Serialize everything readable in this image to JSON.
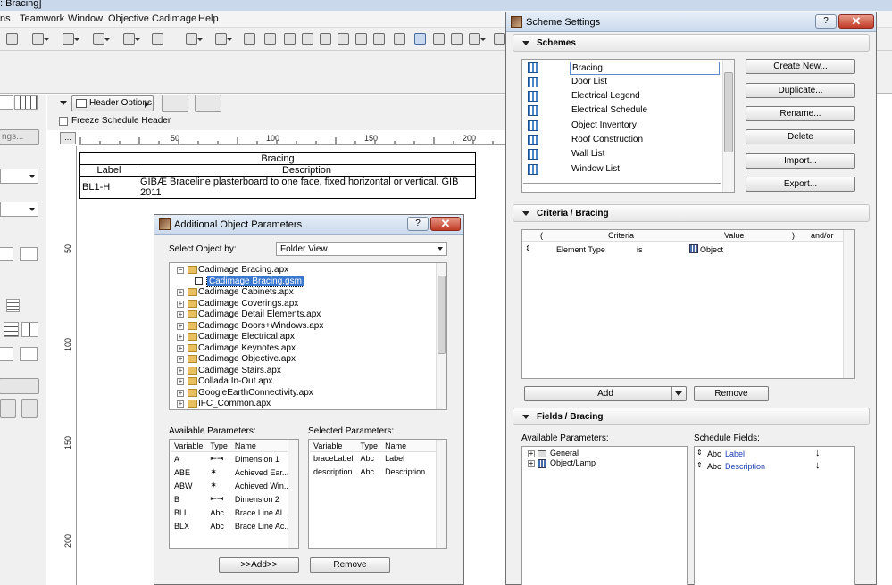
{
  "app": {
    "title_fragment": ": Bracing]",
    "menu": [
      "ns",
      "Teamwork",
      "Window",
      "Objective",
      "Cadimage",
      "Help"
    ]
  },
  "schedule": {
    "header_options_label": "Header Options",
    "freeze_label": "Freeze Schedule Header",
    "ruler_button": "...",
    "ruler_marks": [
      "50",
      "100",
      "150",
      "200"
    ],
    "vruler_marks": [
      "50",
      "100",
      "150",
      "200"
    ],
    "left_labels": {
      "ngs": "ngs..."
    },
    "table": {
      "title": "Bracing",
      "col_label": "Label",
      "col_description": "Description",
      "row": {
        "label": "BL1-H",
        "description": "GIBÆ Braceline plasterboard to one face, fixed horizontal  or vertical. GIB 2011"
      }
    }
  },
  "additional_object_parameters": {
    "title": "Additional Object Parameters",
    "help": "?",
    "select_label": "Select Object by:",
    "select_value": "Folder View",
    "tree": [
      {
        "label": "Cadimage Bracing.apx",
        "expanded": true
      },
      {
        "label": "Cadimage Bracing.gsm",
        "child": true,
        "selected": true
      },
      {
        "label": "Cadimage Cabinets.apx"
      },
      {
        "label": "Cadimage Coverings.apx"
      },
      {
        "label": "Cadimage Detail Elements.apx"
      },
      {
        "label": "Cadimage Doors+Windows.apx"
      },
      {
        "label": "Cadimage Electrical.apx"
      },
      {
        "label": "Cadimage Keynotes.apx"
      },
      {
        "label": "Cadimage Objective.apx"
      },
      {
        "label": "Cadimage Stairs.apx"
      },
      {
        "label": "Collada In-Out.apx"
      },
      {
        "label": "GoogleEarthConnectivity.apx"
      },
      {
        "label": "IFC_Common.apx"
      }
    ],
    "available_label": "Available Parameters:",
    "selected_label": "Selected Parameters:",
    "columns": {
      "variable": "Variable",
      "type": "Type",
      "name": "Name"
    },
    "available": [
      {
        "variable": "A",
        "type_icon": "dimension-icon",
        "name": "Dimension 1"
      },
      {
        "variable": "ABE",
        "type_icon": "angle-icon",
        "name": "Achieved Ear..."
      },
      {
        "variable": "ABW",
        "type_icon": "angle-icon",
        "name": "Achieved Win..."
      },
      {
        "variable": "B",
        "type_icon": "dimension-icon",
        "name": "Dimension 2"
      },
      {
        "variable": "BLL",
        "type": "Abc",
        "name": "Brace Line Al..."
      },
      {
        "variable": "BLX",
        "type": "Abc",
        "name": "Brace Line Ac..."
      }
    ],
    "selected": [
      {
        "variable": "braceLabel",
        "type": "Abc",
        "name": "Label"
      },
      {
        "variable": "description",
        "type": "Abc",
        "name": "Description"
      }
    ],
    "add_button": ">>Add>>",
    "remove_button": "Remove"
  },
  "scheme_settings": {
    "title": "Scheme Settings",
    "help": "?",
    "close": "✕",
    "schemes_header": "Schemes",
    "schemes": [
      "Bracing",
      "Door List",
      "Electrical Legend",
      "Electrical Schedule",
      "Object Inventory",
      "Roof Construction",
      "Wall List",
      "Window List"
    ],
    "buttons": [
      "Create New...",
      "Duplicate...",
      "Rename...",
      "Delete",
      "Import...",
      "Export..."
    ],
    "criteria_header": "Criteria /  Bracing",
    "criteria_columns": {
      "open": "(",
      "criteria": "Criteria",
      "value": "Value",
      "close": ")",
      "andor": "and/or"
    },
    "criteria_row": {
      "criteria": "Element Type",
      "op": "is",
      "value": "Object"
    },
    "criteria_add": "Add",
    "criteria_remove": "Remove",
    "fields_header": "Fields /  Bracing",
    "available_label": "Available Parameters:",
    "schedule_fields_label": "Schedule Fields:",
    "available_tree": [
      "General",
      "Object/Lamp"
    ],
    "schedule_fields": [
      {
        "type": "Abc",
        "name": "Label"
      },
      {
        "type": "Abc",
        "name": "Description"
      }
    ]
  }
}
